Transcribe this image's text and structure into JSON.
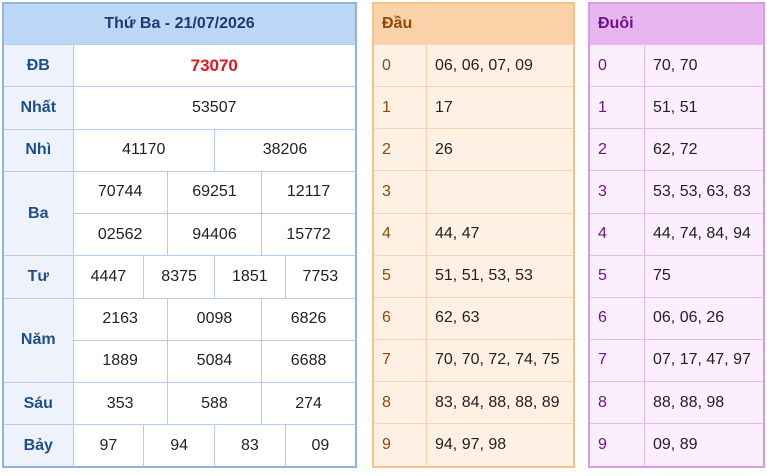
{
  "results": {
    "title": "Thứ Ba - 21/07/2026",
    "db": {
      "label": "ĐB",
      "values": [
        "73070"
      ]
    },
    "nhat": {
      "label": "Nhất",
      "values": [
        "53507"
      ]
    },
    "nhi": {
      "label": "Nhì",
      "values": [
        "41170",
        "38206"
      ]
    },
    "ba": {
      "label": "Ba",
      "values": [
        "70744",
        "69251",
        "12117",
        "02562",
        "94406",
        "15772"
      ]
    },
    "tu": {
      "label": "Tư",
      "values": [
        "4447",
        "8375",
        "1851",
        "7753"
      ]
    },
    "nam": {
      "label": "Năm",
      "values": [
        "2163",
        "0098",
        "6826",
        "1889",
        "5084",
        "6688"
      ]
    },
    "sau": {
      "label": "Sáu",
      "values": [
        "353",
        "588",
        "274"
      ]
    },
    "bay": {
      "label": "Bảy",
      "values": [
        "97",
        "94",
        "83",
        "09"
      ]
    }
  },
  "dau": {
    "title": "Đầu",
    "rows": [
      {
        "k": "0",
        "v": "06, 06, 07, 09"
      },
      {
        "k": "1",
        "v": "17"
      },
      {
        "k": "2",
        "v": "26"
      },
      {
        "k": "3",
        "v": ""
      },
      {
        "k": "4",
        "v": "44, 47"
      },
      {
        "k": "5",
        "v": "51, 51, 53, 53"
      },
      {
        "k": "6",
        "v": "62, 63"
      },
      {
        "k": "7",
        "v": "70, 70, 72, 74, 75"
      },
      {
        "k": "8",
        "v": "83, 84, 88, 88, 89"
      },
      {
        "k": "9",
        "v": "94, 97, 98"
      }
    ]
  },
  "duoi": {
    "title": "Đuôi",
    "rows": [
      {
        "k": "0",
        "v": "70, 70"
      },
      {
        "k": "1",
        "v": "51, 51"
      },
      {
        "k": "2",
        "v": "62, 72"
      },
      {
        "k": "3",
        "v": "53, 53, 63, 83"
      },
      {
        "k": "4",
        "v": "44, 74, 84, 94"
      },
      {
        "k": "5",
        "v": "75"
      },
      {
        "k": "6",
        "v": "06, 06, 26"
      },
      {
        "k": "7",
        "v": "07, 17, 47, 97"
      },
      {
        "k": "8",
        "v": "88, 88, 98"
      },
      {
        "k": "9",
        "v": "09, 89"
      }
    ]
  },
  "colors": {
    "special": "#e3141b",
    "results_header": "#bcd6f6",
    "dau_header": "#fbd2a8",
    "duoi_header": "#e8b5f0"
  }
}
